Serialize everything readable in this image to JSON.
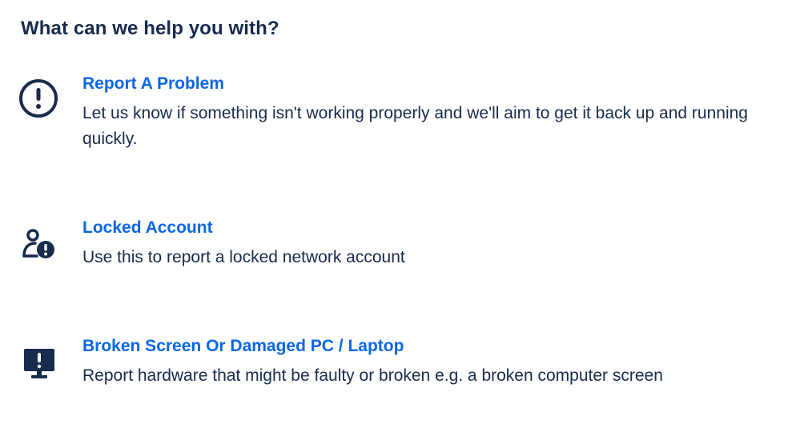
{
  "heading": "What can we help you with?",
  "accent_color": "#0c66e4",
  "text_color": "#172b4d",
  "options": [
    {
      "icon": "error-circle-icon",
      "title": "Report A Problem",
      "description": "Let us know if something isn't working properly and we'll aim to get it back up and running quickly."
    },
    {
      "icon": "locked-account-icon",
      "title": "Locked Account",
      "description": "Use this to report a locked network account"
    },
    {
      "icon": "monitor-warning-icon",
      "title": "Broken Screen Or Damaged PC / Laptop",
      "description": "Report hardware that might be faulty or broken e.g. a broken computer screen"
    }
  ]
}
